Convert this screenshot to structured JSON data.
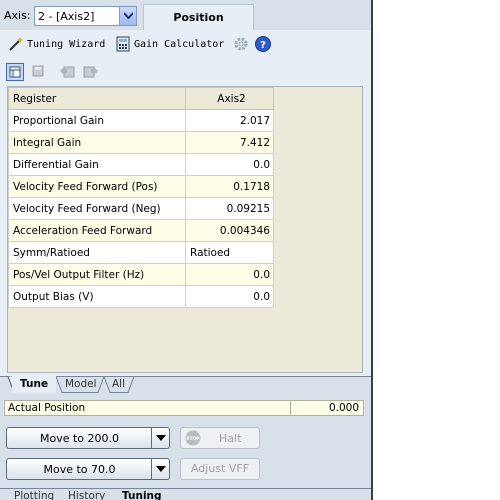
{
  "header": {
    "axis_label": "Axis:",
    "axis_value": "2 - [Axis2]",
    "position_tab": "Position"
  },
  "toolbar": {
    "tuning_wizard": "Tuning Wizard",
    "gain_calculator": "Gain Calculator"
  },
  "grid": {
    "col_register": "Register",
    "col_axis": "Axis2",
    "rows": [
      {
        "name": "Proportional Gain",
        "value": "2.017"
      },
      {
        "name": "Integral Gain",
        "value": "7.412"
      },
      {
        "name": "Differential Gain",
        "value": "0.0"
      },
      {
        "name": "Velocity Feed Forward (Pos)",
        "value": "0.1718"
      },
      {
        "name": "Velocity Feed Forward (Neg)",
        "value": "0.09215"
      },
      {
        "name": "Acceleration Feed Forward",
        "value": "0.004346"
      },
      {
        "name": "Symm/Ratioed",
        "value": "Ratioed"
      },
      {
        "name": "Pos/Vel Output Filter (Hz)",
        "value": "0.0"
      },
      {
        "name": "Output Bias (V)",
        "value": "0.0"
      }
    ]
  },
  "tabs": [
    "Tune",
    "Model",
    "All"
  ],
  "actual_position": {
    "label": "Actual Position",
    "value": "0.000"
  },
  "buttons": {
    "move1": "Move to 200.0",
    "move2": "Move to 70.0",
    "halt": "Halt",
    "halt_badge": "STOP",
    "adjust_vff": "Adjust VFF"
  },
  "bottom_tabs": [
    "Plotting",
    "History",
    "Tuning"
  ],
  "colors": {
    "accent": "#1f4fb5",
    "panel": "#d8e0ea",
    "grid_alt": "#fffde8"
  }
}
